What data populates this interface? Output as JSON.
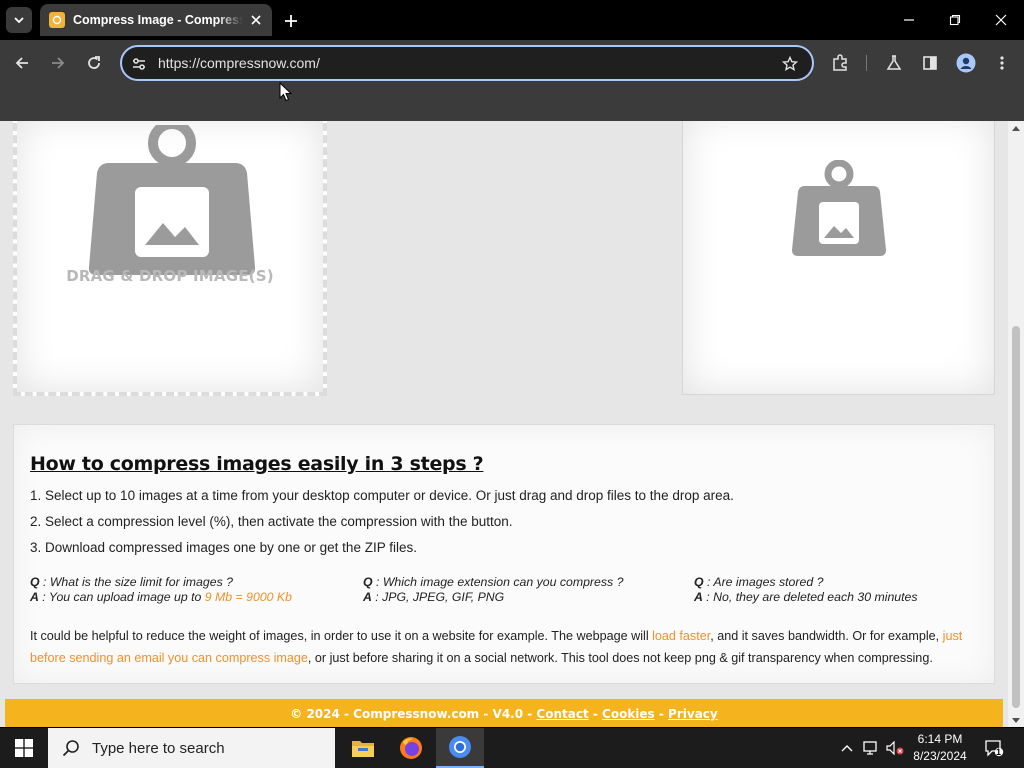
{
  "browser": {
    "tab_title": "Compress Image - Compressnow",
    "url": "https://compressnow.com/"
  },
  "page": {
    "drop_text": "DRAG & DROP IMAGE(S)",
    "heading": "How to compress images easily in 3 steps ?",
    "steps": [
      "1. Select up to 10 images at a time from your desktop computer or device. Or just drag and drop files to the drop area.",
      "2. Select a compression level (%), then activate the compression with the button.",
      "3. Download compressed images one by one or get the ZIP files."
    ],
    "faq": [
      {
        "q_label": "Q",
        "q": " : What is the size limit for images ?",
        "a_label": "A",
        "a": " : You can upload image up to ",
        "a_highlight": "9 Mb = 9000 Kb"
      },
      {
        "q_label": "Q",
        "q": " : Which image extension can you compress ?",
        "a_label": "A",
        "a": " : JPG, JPEG, GIF, PNG",
        "a_highlight": ""
      },
      {
        "q_label": "Q",
        "q": " : Are images stored ?",
        "a_label": "A",
        "a": " : No, they are deleted each 30 minutes",
        "a_highlight": ""
      }
    ],
    "para_1": "It could be helpful to reduce the weight of images, in order to use it on a website for example. The webpage will ",
    "para_link_1": "load faster",
    "para_2": ", and it saves bandwidth. Or for example, ",
    "para_link_2": "just before sending an email you can compress image",
    "para_3": ", or just before sharing it on a social network. This tool does not keep png & gif transparency when compressing.",
    "footer": {
      "copyright": "© 2024 - Compressnow.com - V4.0 - ",
      "contact": "Contact",
      "sep1": " - ",
      "cookies": "Cookies",
      "sep2": " - ",
      "privacy": "Privacy"
    }
  },
  "taskbar": {
    "search_placeholder": "Type here to search",
    "time": "6:14 PM",
    "date": "8/23/2024",
    "notification_count": "1"
  },
  "colors": {
    "accent": "#f5b41e",
    "link_orange": "#f0902a",
    "omnibox_focus": "#a8c7fa"
  }
}
